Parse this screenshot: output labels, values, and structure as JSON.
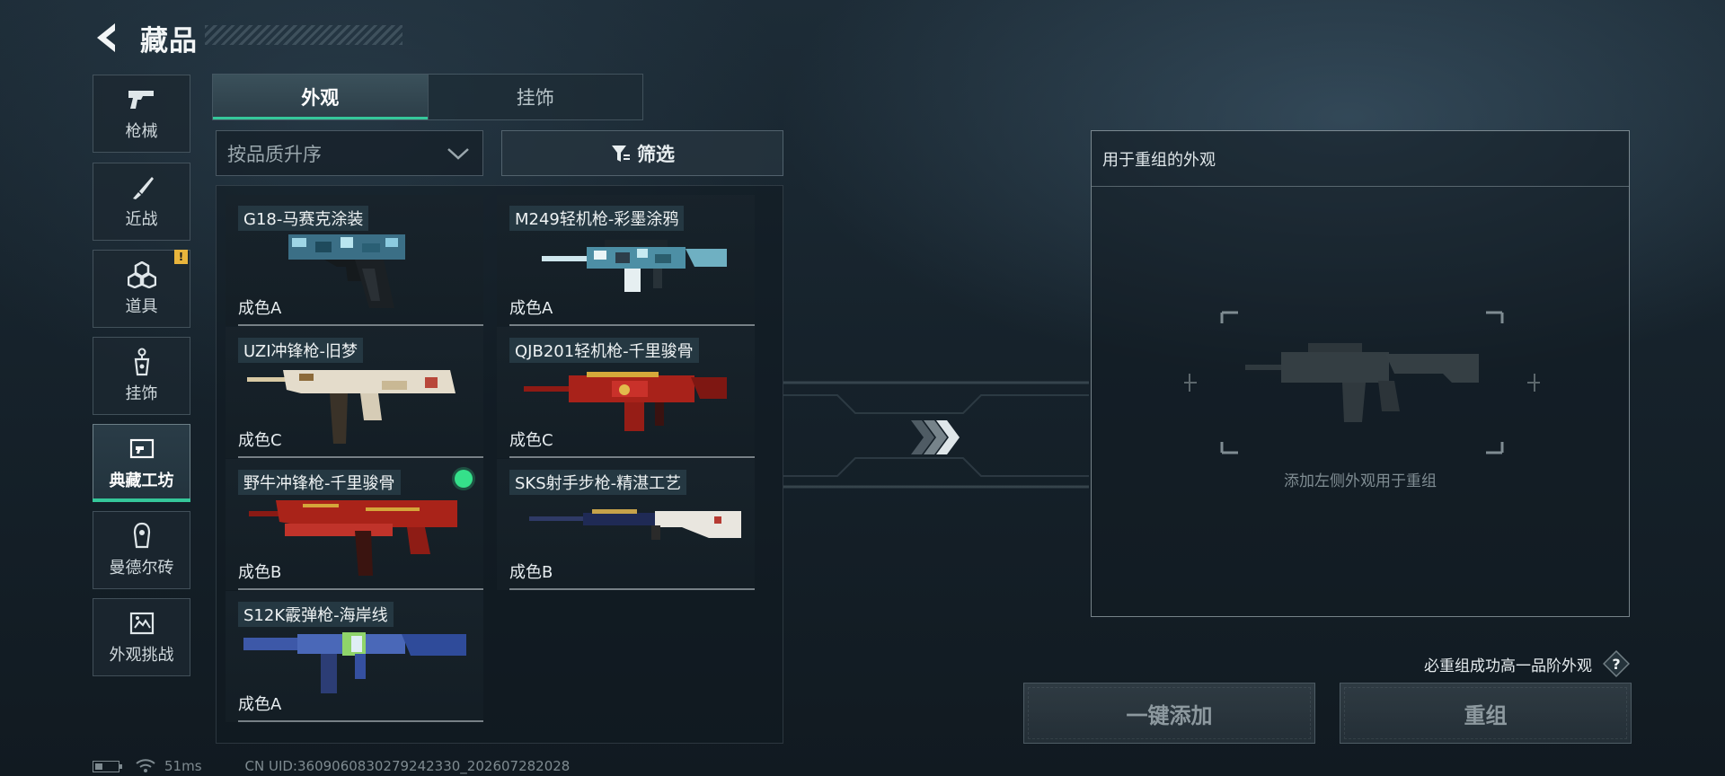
{
  "header": {
    "title": "藏品"
  },
  "sidebar": {
    "items": [
      {
        "label": "枪械",
        "icon": "pistol-icon"
      },
      {
        "label": "近战",
        "icon": "knife-icon"
      },
      {
        "label": "道具",
        "icon": "cubes-icon",
        "badge": "!"
      },
      {
        "label": "挂饰",
        "icon": "charm-icon"
      },
      {
        "label": "典藏工坊",
        "icon": "workshop-icon",
        "active": true
      },
      {
        "label": "曼德尔砖",
        "icon": "brick-icon"
      },
      {
        "label": "外观挑战",
        "icon": "challenge-icon"
      }
    ]
  },
  "tabs": [
    {
      "label": "外观",
      "active": true
    },
    {
      "label": "挂饰",
      "active": false
    }
  ],
  "sort": {
    "value": "按品质升序"
  },
  "filter": {
    "label": "筛选"
  },
  "items": [
    {
      "name": "G18-马赛克涂装",
      "grade": "成色A",
      "icon": "pistol-skin-icon"
    },
    {
      "name": "M249轻机枪-彩墨涂鸦",
      "grade": "成色A",
      "icon": "lmg-skin-icon"
    },
    {
      "name": "UZI冲锋枪-旧梦",
      "grade": "成色C",
      "icon": "smg-skin-icon"
    },
    {
      "name": "QJB201轻机枪-千里骏骨",
      "grade": "成色C",
      "icon": "lmg-skin-icon"
    },
    {
      "name": "野牛冲锋枪-千里骏骨",
      "grade": "成色B",
      "icon": "smg-skin-icon",
      "selected": true
    },
    {
      "name": "SKS射手步枪-精湛工艺",
      "grade": "成色B",
      "icon": "rifle-skin-icon"
    },
    {
      "name": "S12K霰弹枪-海岸线",
      "grade": "成色A",
      "icon": "shotgun-skin-icon"
    }
  ],
  "recombine": {
    "panel_title": "用于重组的外观",
    "placeholder": "添加左侧外观用于重组",
    "hint": "必重组成功高一品阶外观",
    "add_all_label": "一键添加",
    "recombine_label": "重组"
  },
  "status": {
    "ping": "51ms",
    "uid": "CN UID:3609060830279242330_202607282028"
  },
  "colors": {
    "accent": "#35c79a",
    "selected_dot": "#35e08a",
    "warning_badge": "#e8b43c"
  }
}
